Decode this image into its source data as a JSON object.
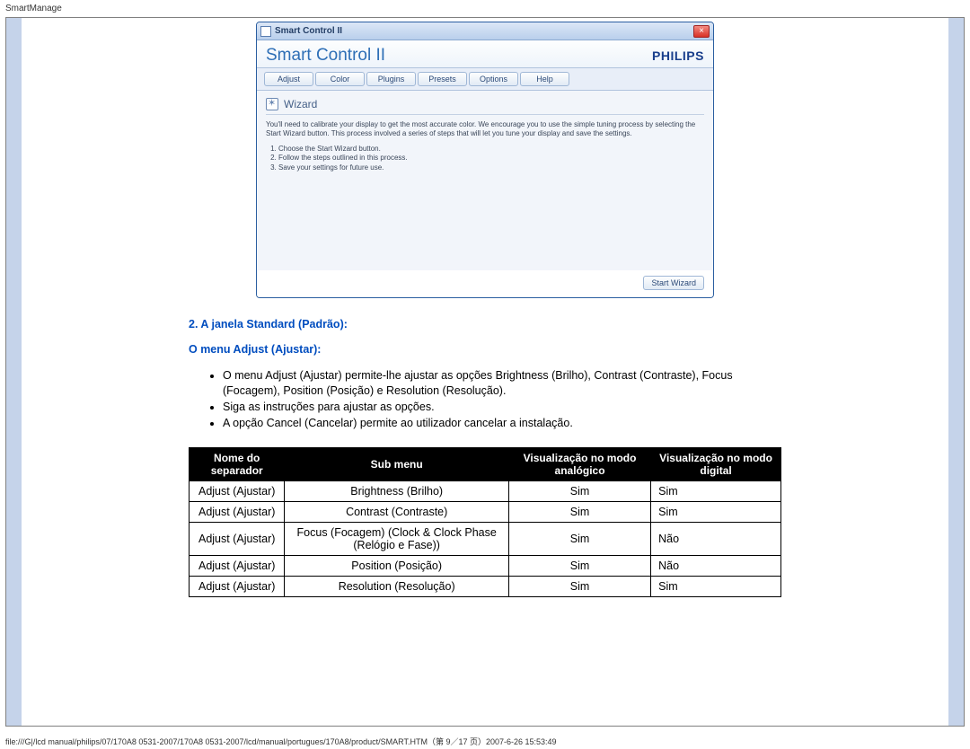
{
  "page_header": "SmartManage",
  "app": {
    "titlebar": "Smart Control II",
    "heading": "Smart Control II",
    "brand": "PHILIPS",
    "tabs": [
      "Adjust",
      "Color",
      "Plugins",
      "Presets",
      "Options",
      "Help"
    ],
    "wizard_label": "Wizard",
    "wizard_intro": "You'll need to calibrate your display to get the most accurate color. We encourage you to use the simple tuning process by selecting the Start Wizard button. This process involved a series of steps that will let you tune your display and save the settings.",
    "wizard_steps": [
      "Choose the Start Wizard button.",
      "Follow the steps outlined in this process.",
      "Save your settings for future use."
    ],
    "start_wizard_btn": "Start Wizard"
  },
  "doc": {
    "heading_standard": "2. A janela Standard (Padrão):",
    "heading_adjust": "O menu Adjust (Ajustar):",
    "bullets": [
      "O menu Adjust (Ajustar) permite-lhe ajustar as opções Brightness (Brilho), Contrast (Contraste), Focus (Focagem), Position (Posição) e Resolution (Resolução).",
      "Siga as instruções para ajustar as opções.",
      "A opção Cancel (Cancelar) permite ao utilizador cancelar a instalação."
    ],
    "table": {
      "headers": [
        "Nome do separador",
        "Sub menu",
        "Visualização no modo analógico",
        "Visualização no modo digital"
      ],
      "rows": [
        [
          "Adjust (Ajustar)",
          "Brightness (Brilho)",
          "Sim",
          "Sim"
        ],
        [
          "Adjust (Ajustar)",
          "Contrast (Contraste)",
          "Sim",
          "Sim"
        ],
        [
          "Adjust (Ajustar)",
          "Focus (Focagem) (Clock & Clock Phase (Relógio e Fase))",
          "Sim",
          "Não"
        ],
        [
          "Adjust (Ajustar)",
          "Position (Posição)",
          "Sim",
          "Não"
        ],
        [
          "Adjust (Ajustar)",
          "Resolution (Resolução)",
          "Sim",
          "Sim"
        ]
      ]
    }
  },
  "footer": "file:///G|/lcd manual/philips/07/170A8 0531-2007/170A8 0531-2007/lcd/manual/portugues/170A8/product/SMART.HTM（第 9／17 页）2007-6-26 15:53:49"
}
